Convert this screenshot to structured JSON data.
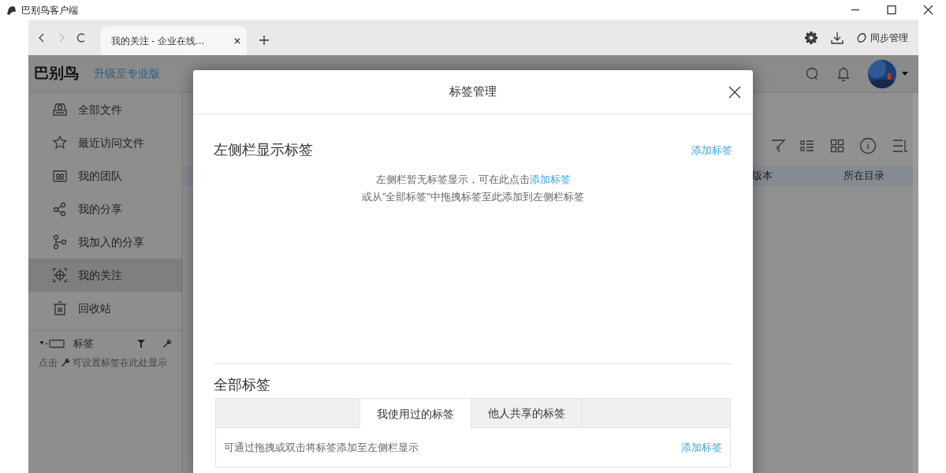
{
  "window": {
    "title": "巴别鸟客户端"
  },
  "browser": {
    "nav_buttons": [
      {
        "kind": "back",
        "disabled": false
      },
      {
        "kind": "forward",
        "disabled": true
      },
      {
        "kind": "reload",
        "disabled": false
      }
    ],
    "tabs": [
      {
        "label": "我的关注 - 企业在线…",
        "selected": true
      }
    ],
    "sync_label": "同步管理"
  },
  "app": {
    "brand": "巴别鸟",
    "upgrade_link": "升级至专业版"
  },
  "sidebar": {
    "items": [
      {
        "label": "全部文件",
        "selected": false
      },
      {
        "label": "最近访问文件",
        "selected": false
      },
      {
        "label": "我的团队",
        "selected": false
      },
      {
        "label": "我的分享",
        "selected": false
      },
      {
        "label": "我加入的分享",
        "selected": false
      },
      {
        "label": "我的关注",
        "selected": true
      },
      {
        "label": "回收站",
        "selected": false
      }
    ],
    "tags": {
      "label": "标签",
      "expanded": true,
      "hint_before": "点击",
      "hint_after": "可设置标签在此处显示"
    }
  },
  "table": {
    "columns": [
      "版本",
      "所在目录"
    ]
  },
  "modal": {
    "title": "标签管理",
    "sidebar_tags": {
      "heading": "左侧栏显示标签",
      "add_link": "添加标签",
      "empty_text": "左侧栏暂无标签显示，可在此点击",
      "empty_link": "添加标签",
      "empty_text_2": "或从\"全部标签\"中拖拽标签至此添加到左侧栏标签"
    },
    "all_tags": {
      "heading": "全部标签",
      "tabs": [
        {
          "label": "我使用过的标签",
          "selected": true
        },
        {
          "label": "他人共享的标签",
          "selected": false
        }
      ],
      "hint": "可通过拖拽或双击将标签添加至左侧栏显示",
      "add_link": "添加标签"
    }
  }
}
